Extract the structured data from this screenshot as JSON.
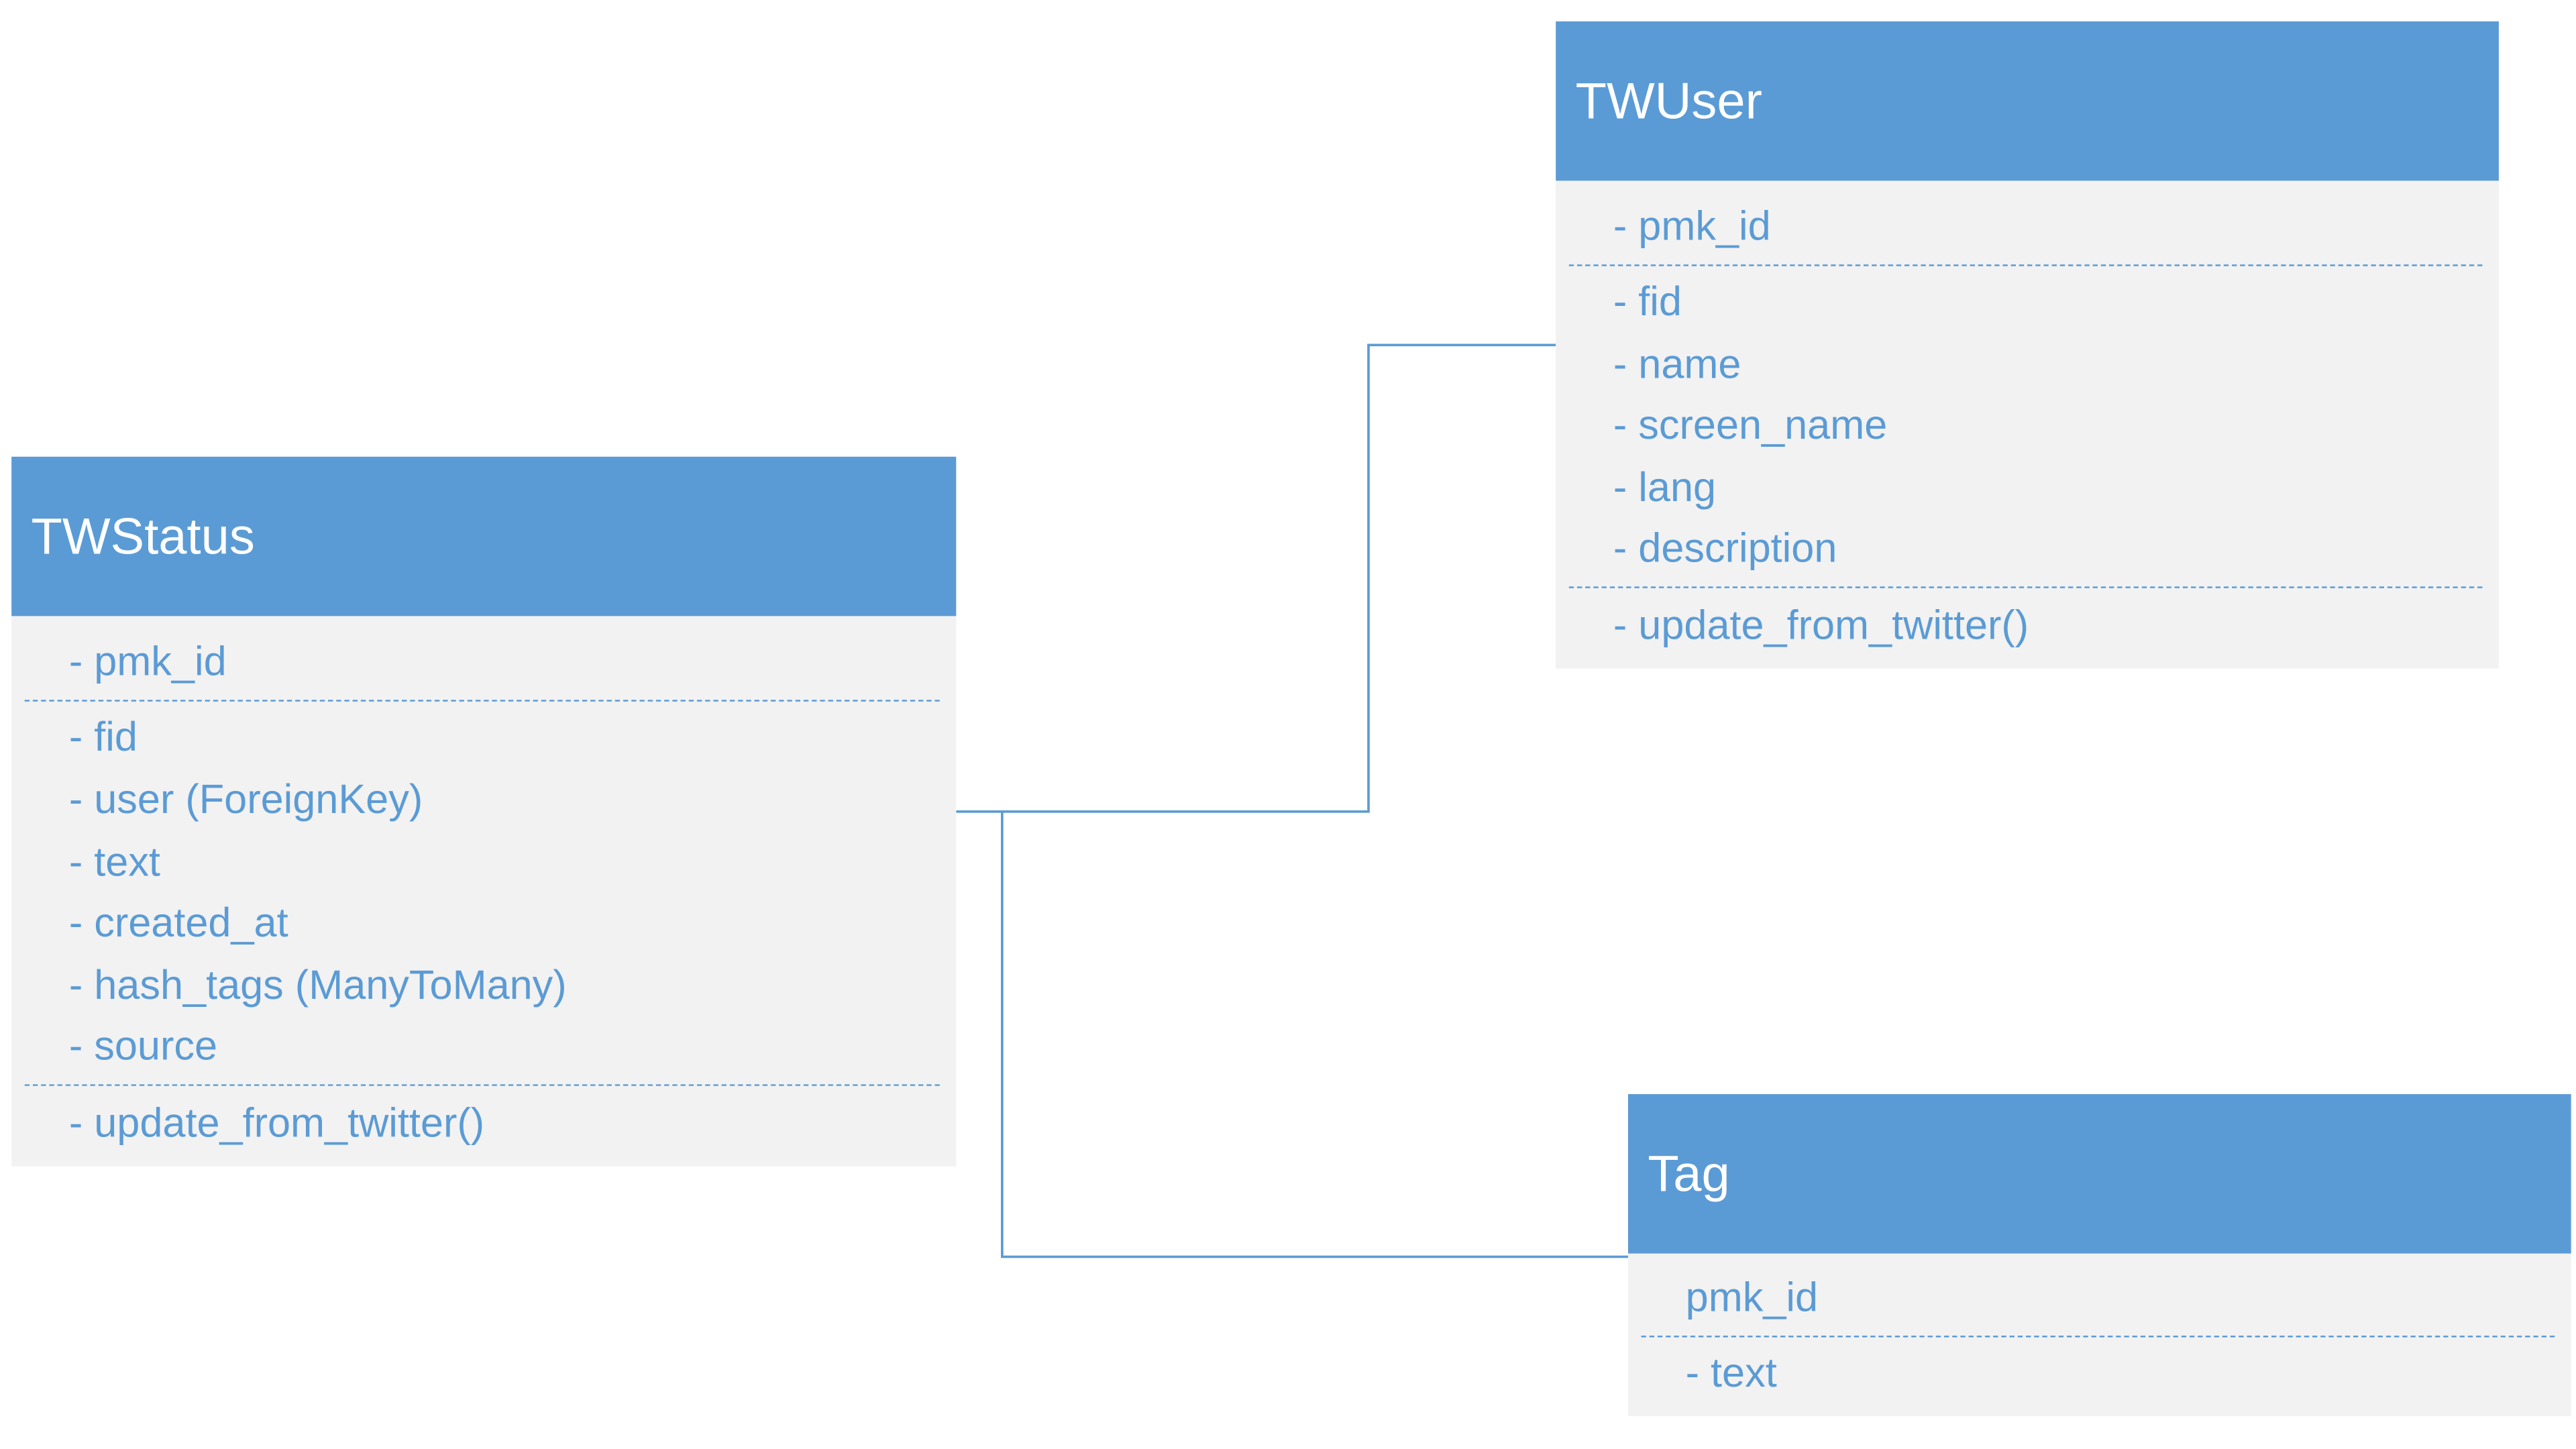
{
  "colors": {
    "header": "#5B9BD5",
    "body": "#F2F2F2",
    "text": "#5B9BD5",
    "connector": "#5B9BD5"
  },
  "classes": {
    "twstatus": {
      "title": "TWStatus",
      "pk": "- pmk_id",
      "fields": [
        "- fid",
        "- user (ForeignKey)",
        "- text",
        "- created_at",
        "- hash_tags (ManyToMany)",
        "- source"
      ],
      "methods": [
        "- update_from_twitter()"
      ]
    },
    "twuser": {
      "title": "TWUser",
      "pk": "- pmk_id",
      "fields": [
        "- fid",
        "- name",
        "- screen_name",
        "- lang",
        "- description"
      ],
      "methods": [
        "- update_from_twitter()"
      ]
    },
    "tag": {
      "title": "Tag",
      "pk": "pmk_id",
      "fields": [
        "- text"
      ]
    }
  }
}
